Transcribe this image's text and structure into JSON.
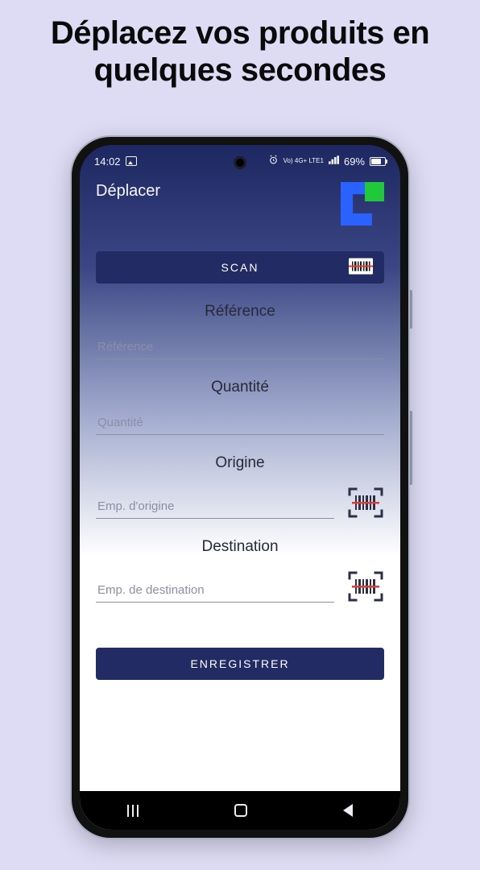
{
  "tagline": "Déplacez vos produits en quelques secondes",
  "statusbar": {
    "time": "14:02",
    "indicators": "Vo) 4G+ LTE1",
    "battery": "69%"
  },
  "header": {
    "title": "Déplacer"
  },
  "buttons": {
    "scan": "SCAN",
    "save": "ENREGISTRER"
  },
  "fields": {
    "reference": {
      "label": "Référence",
      "placeholder": "Référence"
    },
    "quantity": {
      "label": "Quantité",
      "placeholder": "Quantité"
    },
    "origin": {
      "label": "Origine",
      "placeholder": "Emp. d'origine"
    },
    "destination": {
      "label": "Destination",
      "placeholder": "Emp. de destination"
    }
  },
  "colors": {
    "accent": "#222b63",
    "logo_blue": "#2962ff",
    "logo_green": "#22c83c",
    "page_bg": "#dedcf5"
  }
}
